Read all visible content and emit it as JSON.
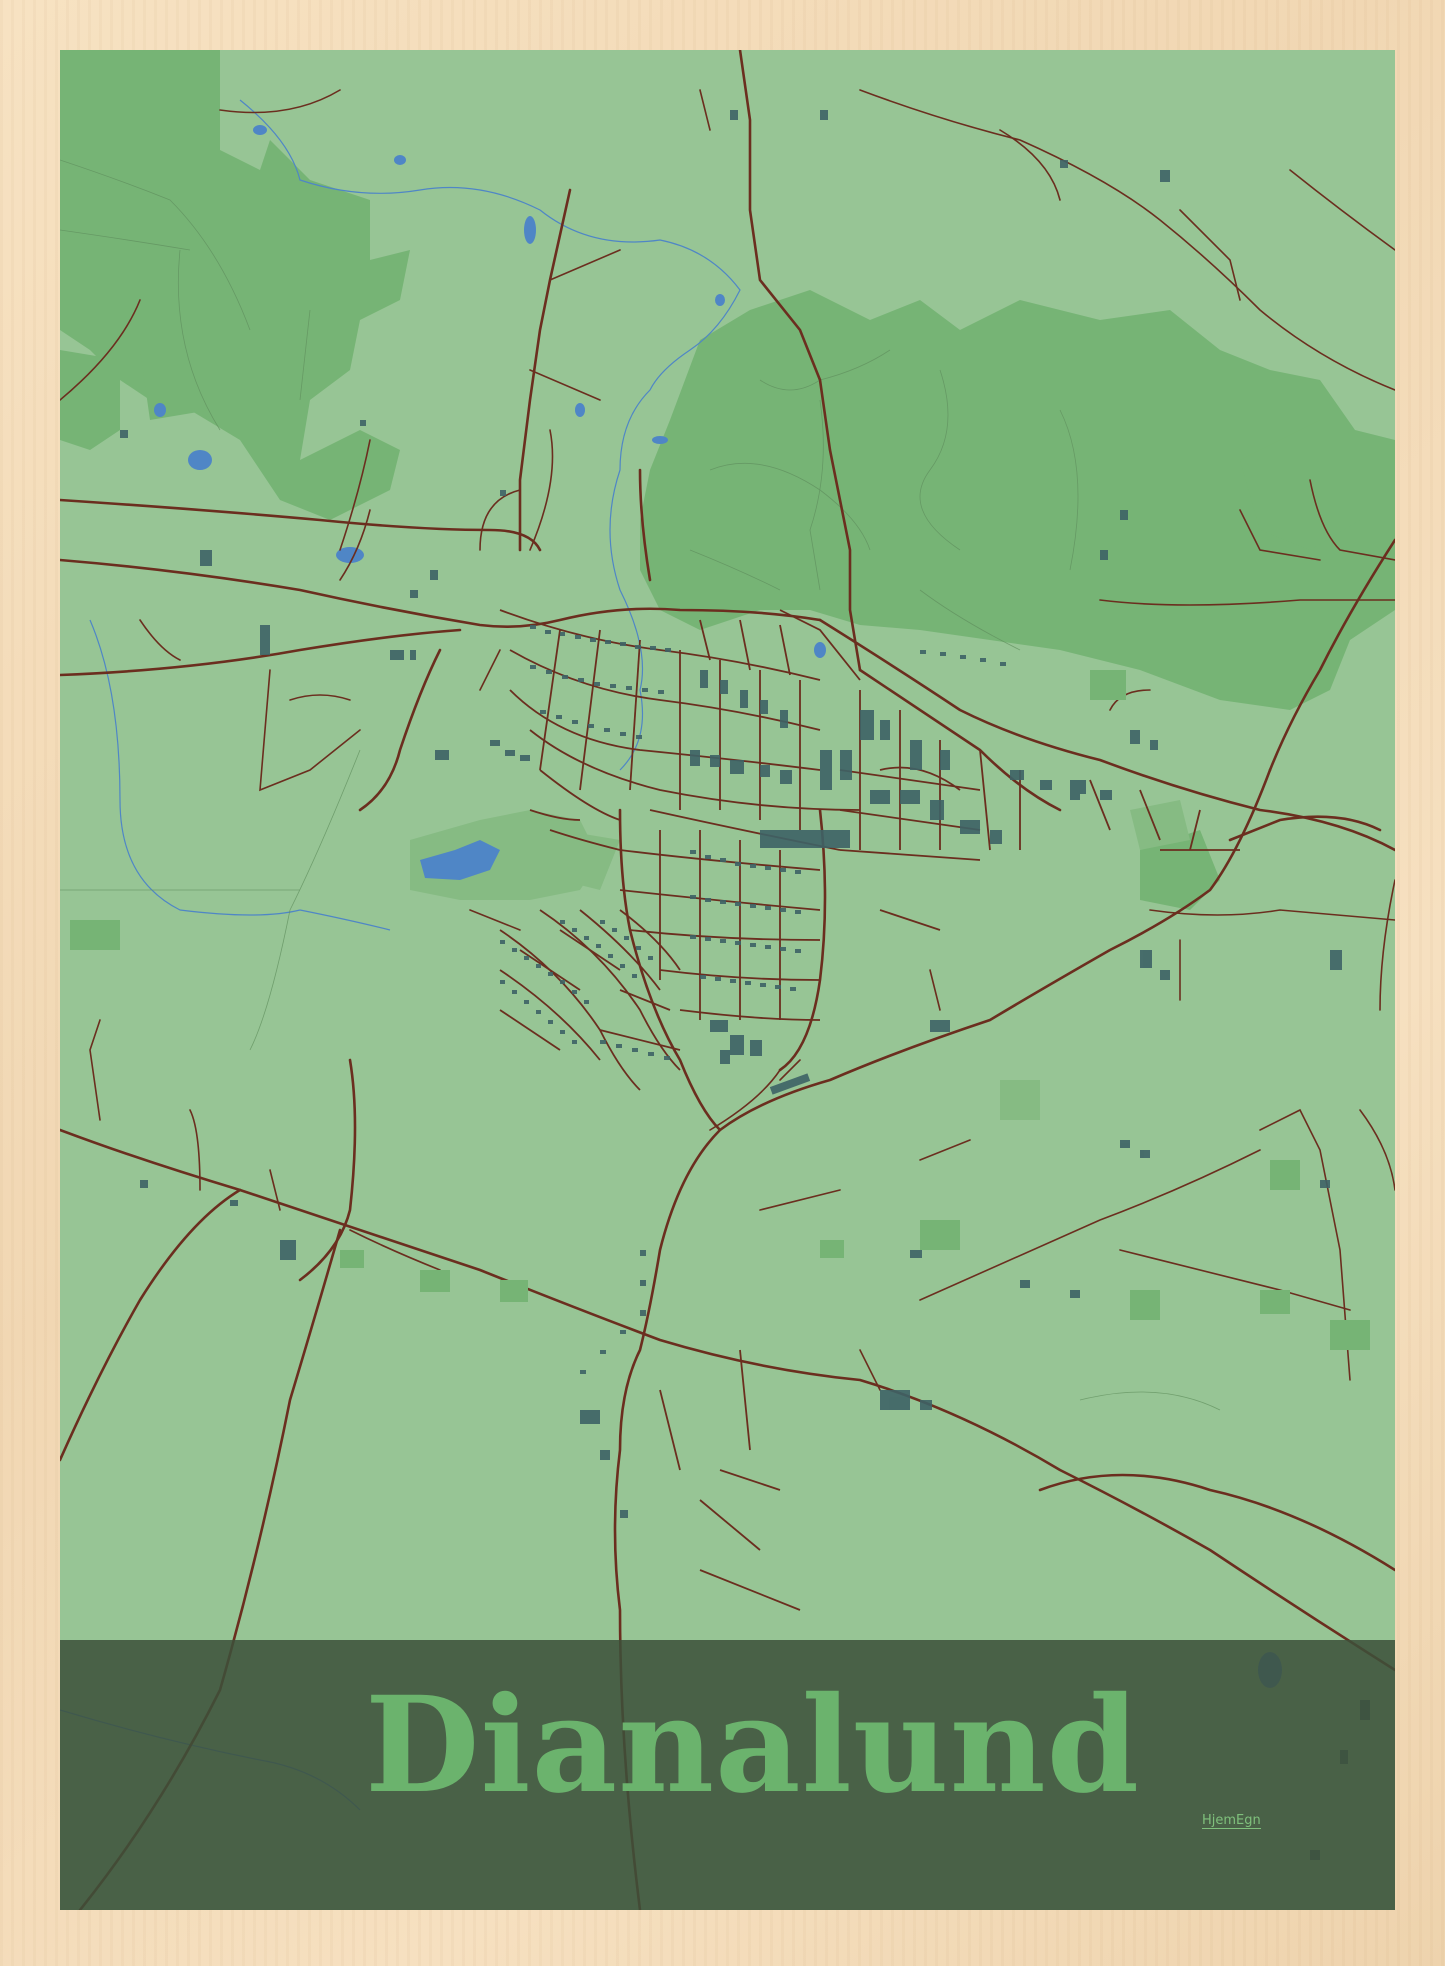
{
  "map": {
    "title": "Dianalund",
    "brand": "HjemEgn",
    "colors": {
      "frame": "#f3dbb8",
      "land": "#97c595",
      "forest": "#76b475",
      "park": "#8dbf8a",
      "water": "#4f86c6",
      "road": "#6b2e1f",
      "building": "#3e6366",
      "band": "#3c503a",
      "title_text": "#6bb36d"
    }
  }
}
